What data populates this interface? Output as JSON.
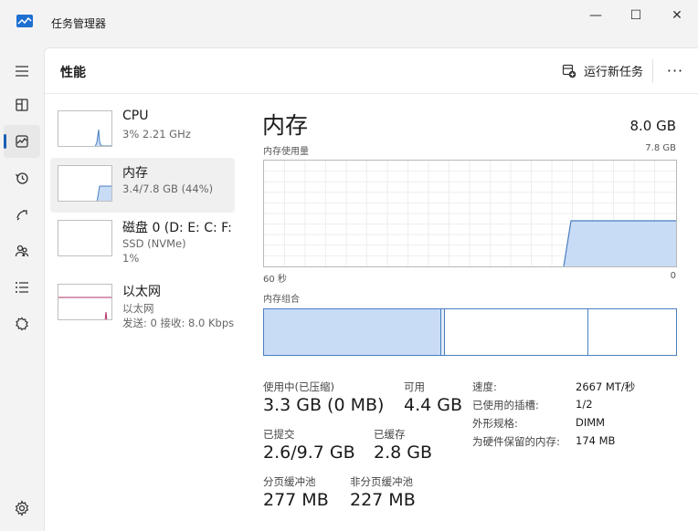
{
  "window": {
    "title": "任务管理器",
    "minimize_glyph": "—",
    "maximize_glyph": "☐",
    "close_glyph": "✕"
  },
  "nav": {
    "items": [
      {
        "name": "hamburger-menu-icon"
      },
      {
        "name": "processes-icon"
      },
      {
        "name": "performance-icon",
        "active": true
      },
      {
        "name": "app-history-icon"
      },
      {
        "name": "startup-apps-icon"
      },
      {
        "name": "users-icon"
      },
      {
        "name": "details-icon"
      },
      {
        "name": "services-icon"
      }
    ],
    "settings_icon": "gear-icon"
  },
  "header": {
    "title": "性能",
    "run_task_label": "运行新任务",
    "more_glyph": "···"
  },
  "resources": [
    {
      "name": "CPU",
      "sub1": "3% 2.21 GHz",
      "sub2": ""
    },
    {
      "name": "内存",
      "sub1": "3.4/7.8 GB (44%)",
      "sub2": "",
      "active": true
    },
    {
      "name": "磁盘 0 (D: E: C: F:",
      "sub1": "SSD (NVMe)",
      "sub2": "1%"
    },
    {
      "name": "以太网",
      "sub1": "以太网",
      "sub2": "发送: 0 接收: 8.0 Kbps"
    }
  ],
  "detail": {
    "title": "内存",
    "total": "8.0 GB",
    "usage_label": "内存使用量",
    "usage_max": "7.8 GB",
    "time_left": "60 秒",
    "time_right": "0",
    "composition_label": "内存组合",
    "usage_fraction": 0.44
  },
  "stats": {
    "in_use_label": "使用中(已压缩)",
    "in_use_value": "3.3 GB (0 MB)",
    "available_label": "可用",
    "available_value": "4.4 GB",
    "committed_label": "已提交",
    "committed_value": "2.6/9.7 GB",
    "cached_label": "已缓存",
    "cached_value": "2.8 GB",
    "paged_label": "分页缓冲池",
    "paged_value": "277 MB",
    "nonpaged_label": "非分页缓冲池",
    "nonpaged_value": "227 MB"
  },
  "specs": [
    {
      "key": "速度:",
      "value": "2667 MT/秒"
    },
    {
      "key": "已使用的插槽:",
      "value": "1/2"
    },
    {
      "key": "外形规格:",
      "value": "DIMM"
    },
    {
      "key": "为硬件保留的内存:",
      "value": "174 MB"
    }
  ],
  "colors": {
    "accent": "#1a5fb4",
    "memory_fill": "#c9dcf6",
    "memory_line": "#4a7fc1",
    "ethernet_line": "#b0306a"
  }
}
